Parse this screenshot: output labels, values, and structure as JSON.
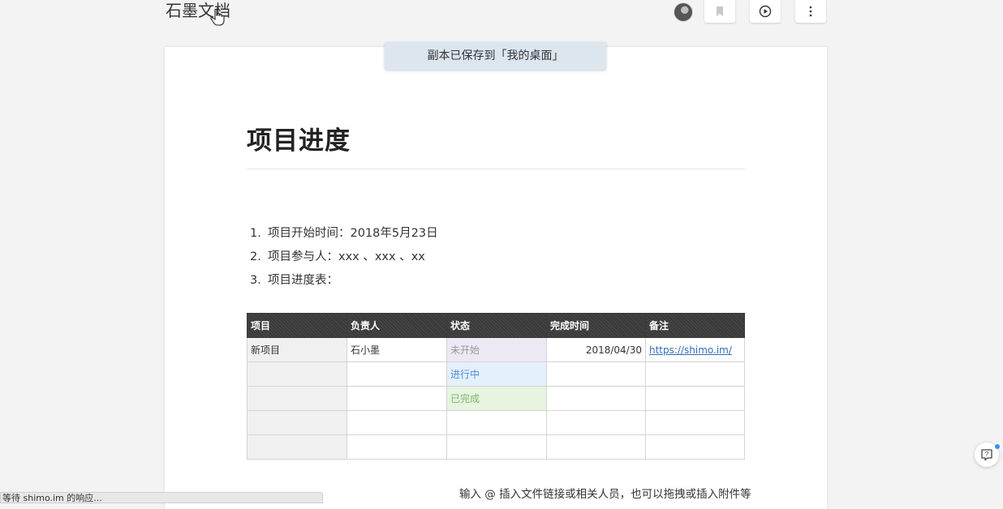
{
  "app": {
    "logo_text": "石墨文档"
  },
  "toolbar": {
    "avatar_icon": "user-avatar",
    "bookmark_icon": "bookmark-icon",
    "present_icon": "play-circle-icon",
    "more_icon": "more-vertical-icon"
  },
  "toast": {
    "message": "副本已保存到「我的桌面」"
  },
  "document": {
    "title": "项目进度",
    "list": [
      {
        "num": "1.",
        "text": "项目开始时间：2018年5月23日"
      },
      {
        "num": "2.",
        "text": "项目参与人：xxx 、xxx 、xx"
      },
      {
        "num": "3.",
        "text": "项目进度表："
      }
    ],
    "table": {
      "headers": [
        "项目",
        "负责人",
        "状态",
        "完成时间",
        "备注"
      ],
      "rows": [
        [
          "新项目",
          "石小墨",
          "未开始",
          "2018/04/30",
          "https://shimo.im/"
        ],
        [
          "",
          "",
          "进行中",
          "",
          ""
        ],
        [
          "",
          "",
          "已完成",
          "",
          ""
        ],
        [
          "",
          "",
          "",
          "",
          ""
        ],
        [
          "",
          "",
          "",
          "",
          ""
        ]
      ]
    },
    "hint": "输入 @ 插入文件链接或相关人员，也可以拖拽或插入附件等"
  },
  "status_bar": {
    "text": "等待 shimo.im 的响应..."
  },
  "colors": {
    "header_bg": "#3a3a3a",
    "pending_bg": "#ede8f4",
    "progress_bg": "#e4f0fb",
    "progress_text": "#4e8fd8",
    "done_bg": "#e6f4e0",
    "done_text": "#7eb56a",
    "toast_bg": "#dce6ef",
    "link": "#2f6fb5"
  }
}
